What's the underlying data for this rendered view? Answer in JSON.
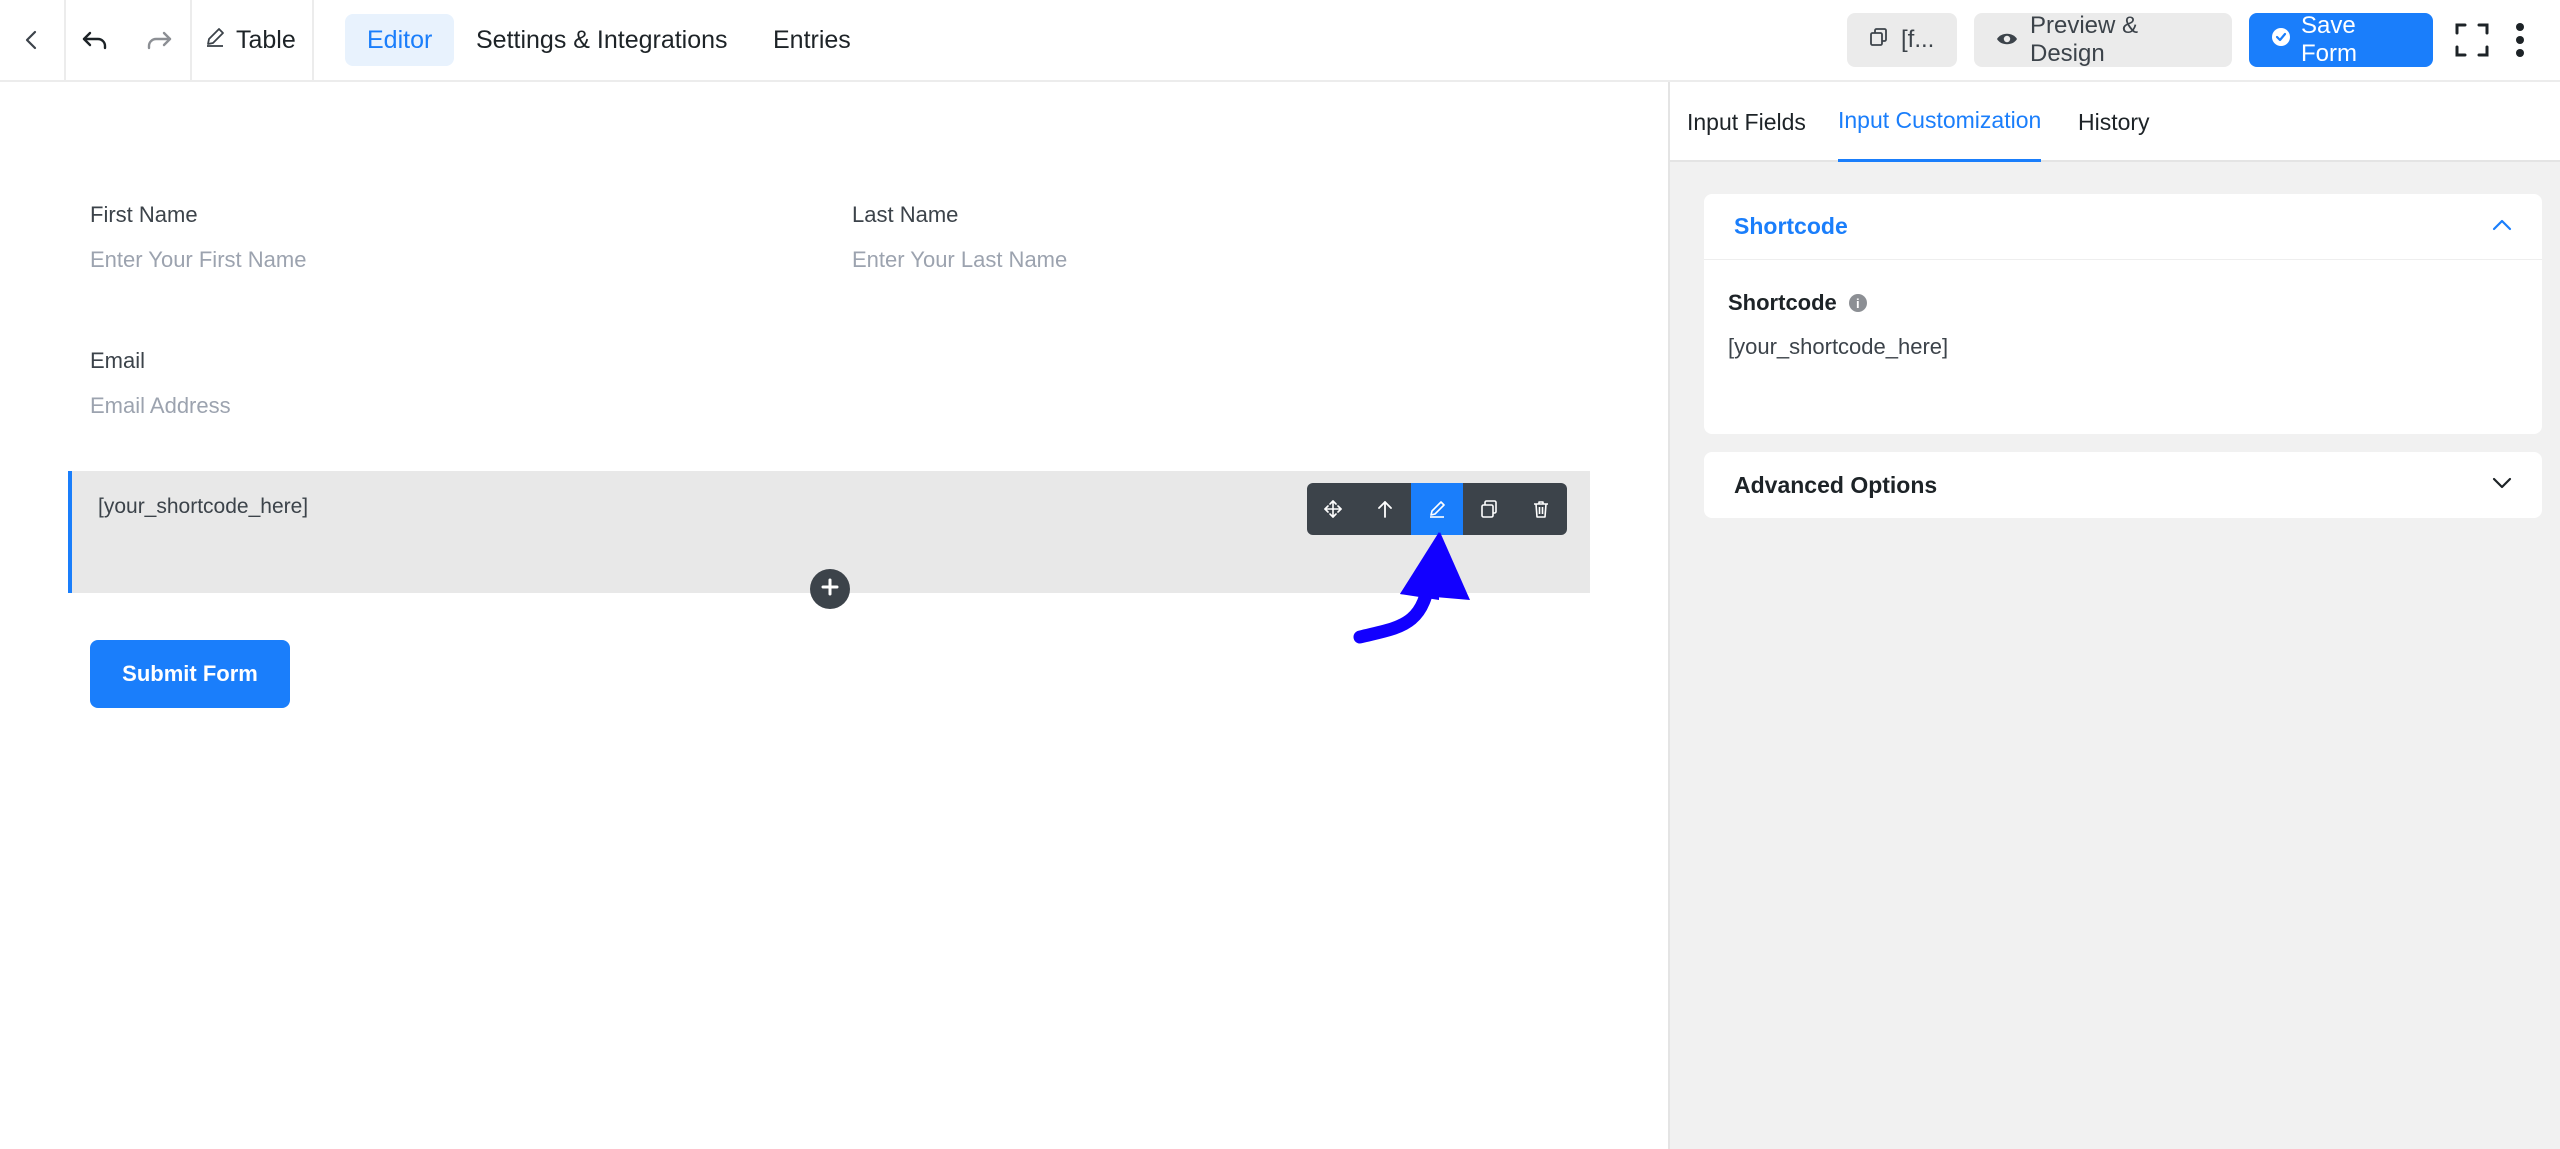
{
  "header": {
    "form_title": "Table",
    "tabs": [
      {
        "label": "Editor",
        "active": true
      },
      {
        "label": "Settings & Integrations",
        "active": false
      },
      {
        "label": "Entries",
        "active": false
      }
    ],
    "shortcode_button": "[f...",
    "preview_button": "Preview & Design",
    "save_button": "Save Form"
  },
  "form": {
    "first_name": {
      "label": "First Name",
      "placeholder": "Enter Your First Name"
    },
    "last_name": {
      "label": "Last Name",
      "placeholder": "Enter Your Last Name"
    },
    "email": {
      "label": "Email",
      "placeholder": "Email Address"
    },
    "shortcode_field": {
      "text": "[your_shortcode_here]"
    },
    "submit_label": "Submit Form"
  },
  "panel": {
    "tabs": [
      {
        "label": "Input Fields",
        "active": false
      },
      {
        "label": "Input Customization",
        "active": true
      },
      {
        "label": "History",
        "active": false
      }
    ],
    "shortcode_section": {
      "title": "Shortcode",
      "field_label": "Shortcode",
      "field_value": "[your_shortcode_here]"
    },
    "advanced_section": {
      "title": "Advanced Options"
    }
  },
  "colors": {
    "accent": "#1a7efb",
    "annotation_arrow": "#1200ff",
    "toolbar": "#3c434a"
  }
}
